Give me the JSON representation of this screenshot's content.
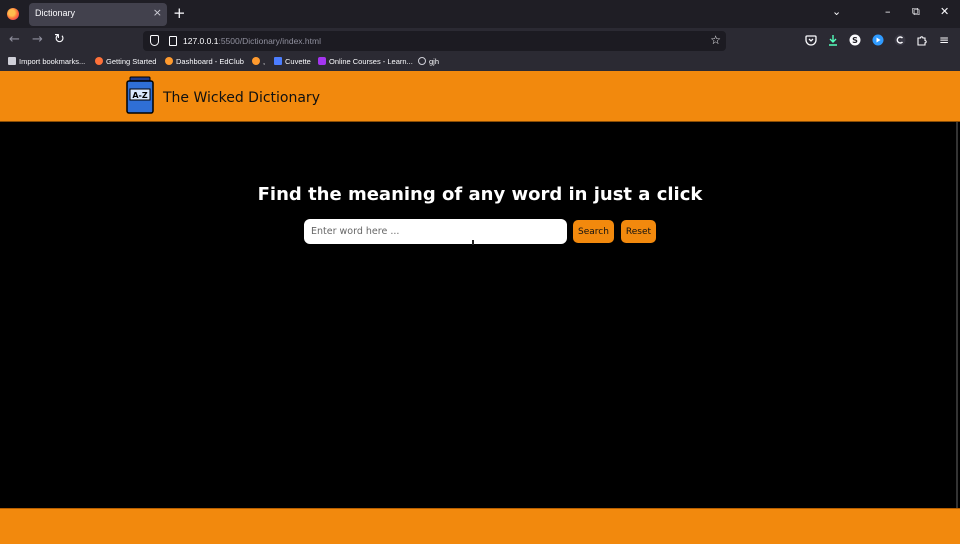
{
  "browser": {
    "tab_title": "Dictionary",
    "tab_close": "×",
    "new_tab": "+",
    "url_host": "127.0.0.1",
    "url_rest": ":5500/Dictionary/index.html",
    "window_controls": [
      "⌄",
      "–",
      "⧉",
      "✕"
    ],
    "nav": {
      "back": "←",
      "forward": "→",
      "reload": "↻"
    },
    "star": "☆",
    "menu": "≡",
    "bookmarks": [
      {
        "label": "Import bookmarks...",
        "icon": "import-icon",
        "color": "#cfcfd8"
      },
      {
        "label": "Getting Started",
        "icon": "firefox-icon",
        "color": "#ff7139"
      },
      {
        "label": "Dashboard - EdClub",
        "icon": "edclub-icon",
        "color": "#ff9a2e"
      },
      {
        "label": ",",
        "icon": "edclub-icon",
        "color": "#ff9a2e"
      },
      {
        "label": "Cuvette",
        "icon": "cuvette-icon",
        "color": "#4c7dff"
      },
      {
        "label": "Online Courses - Learn...",
        "icon": "udemy-icon",
        "color": "#a435f0"
      },
      {
        "label": "gjh",
        "icon": "globe-icon",
        "color": "#cfcfd8"
      }
    ]
  },
  "site": {
    "title": "The Wicked Dictionary",
    "logo_text": "A-Z",
    "headline": "Find the meaning of any word in just a click",
    "search_placeholder": "Enter word here ...",
    "search_value": "",
    "search_button": "Search",
    "reset_button": "Reset",
    "accent_color": "#f2890d"
  }
}
